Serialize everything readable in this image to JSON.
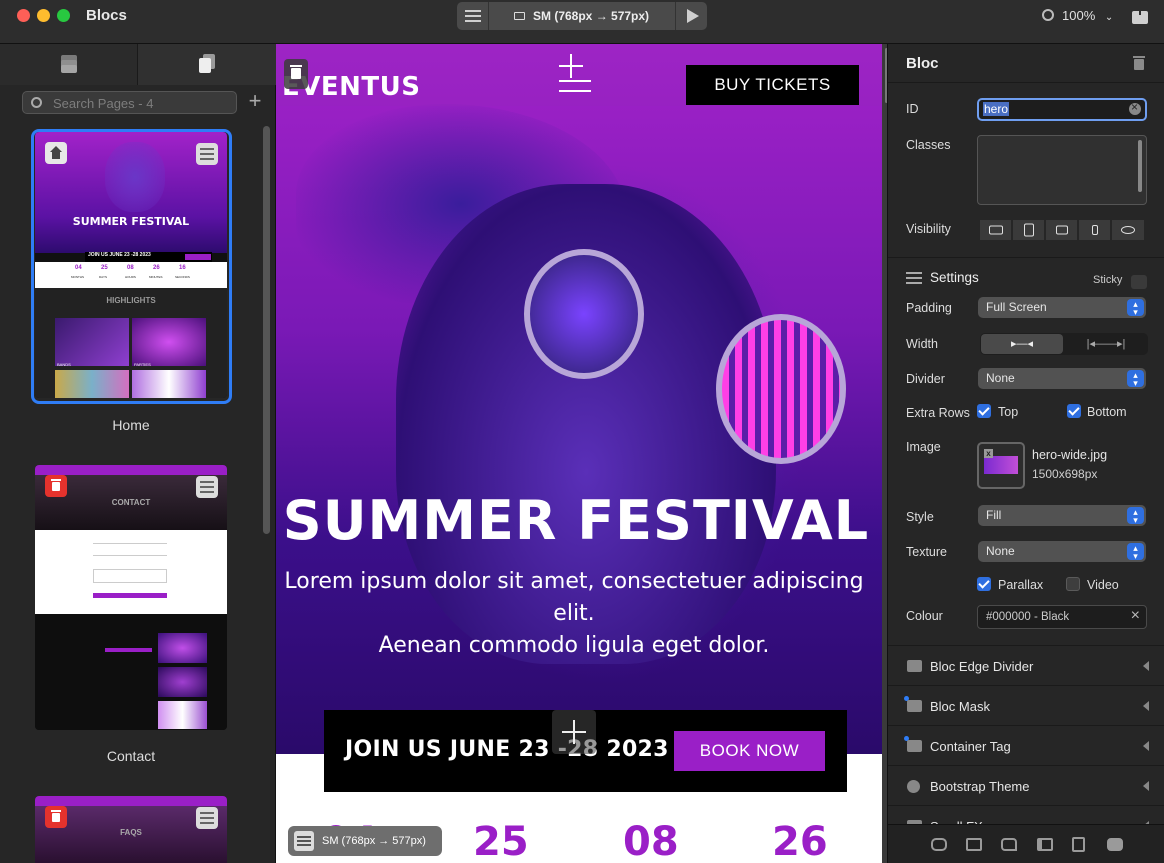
{
  "app": {
    "title": "Blocs",
    "zoom": "100%"
  },
  "device": {
    "label": "SM (768px → 577px)"
  },
  "left_panel": {
    "search_placeholder": "Search Pages - 4",
    "pages": [
      {
        "name": "Home",
        "selected": true
      },
      {
        "name": "Contact",
        "selected": false
      },
      {
        "name": "FAQS",
        "selected": false
      }
    ],
    "thumb_texts": {
      "home_title": "SUMMER FESTIVAL",
      "home_join": "JOIN US JUNE 23 -28 2023",
      "home_counts": [
        "04",
        "25",
        "08",
        "26",
        "16"
      ],
      "home_count_labels": [
        "MONTHS",
        "DAYS",
        "HOURS",
        "MINUTES",
        "SECONDS"
      ],
      "home_highlights": "HIGHLIGHTS",
      "home_cards": [
        "BANDS",
        "PARTIES"
      ],
      "contact_title": "CONTACT",
      "faqs_title": "FAQS"
    }
  },
  "canvas": {
    "logo": "EVENTUS",
    "buy_tickets": "BUY TICKETS",
    "hero_title": "SUMMER FESTIVAL",
    "hero_sub_line1": "Lorem ipsum dolor sit amet, consectetuer adipiscing elit.",
    "hero_sub_line2": "Aenean commodo ligula eget dolor.",
    "join_text": "JOIN US JUNE 23 -28 2023",
    "book_now": "BOOK NOW",
    "counters": [
      "04",
      "25",
      "08",
      "26"
    ],
    "size_badge": "SM (768px → 577px)"
  },
  "inspector": {
    "title": "Bloc",
    "id_label": "ID",
    "id_value": "hero",
    "classes_label": "Classes",
    "visibility_label": "Visibility",
    "settings_label": "Settings",
    "sticky_label": "Sticky",
    "padding_label": "Padding",
    "padding_value": "Full Screen",
    "width_label": "Width",
    "divider_label": "Divider",
    "divider_value": "None",
    "extra_rows_label": "Extra Rows",
    "top_label": "Top",
    "bottom_label": "Bottom",
    "image_label": "Image",
    "image_name": "hero-wide.jpg",
    "image_size": "1500x698px",
    "style_label": "Style",
    "style_value": "Fill",
    "texture_label": "Texture",
    "texture_value": "None",
    "parallax_label": "Parallax",
    "video_label": "Video",
    "colour_label": "Colour",
    "colour_value": "#000000 - Black",
    "sections": [
      "Bloc Edge Divider",
      "Bloc Mask",
      "Container Tag",
      "Bootstrap Theme",
      "Scroll FX"
    ]
  }
}
